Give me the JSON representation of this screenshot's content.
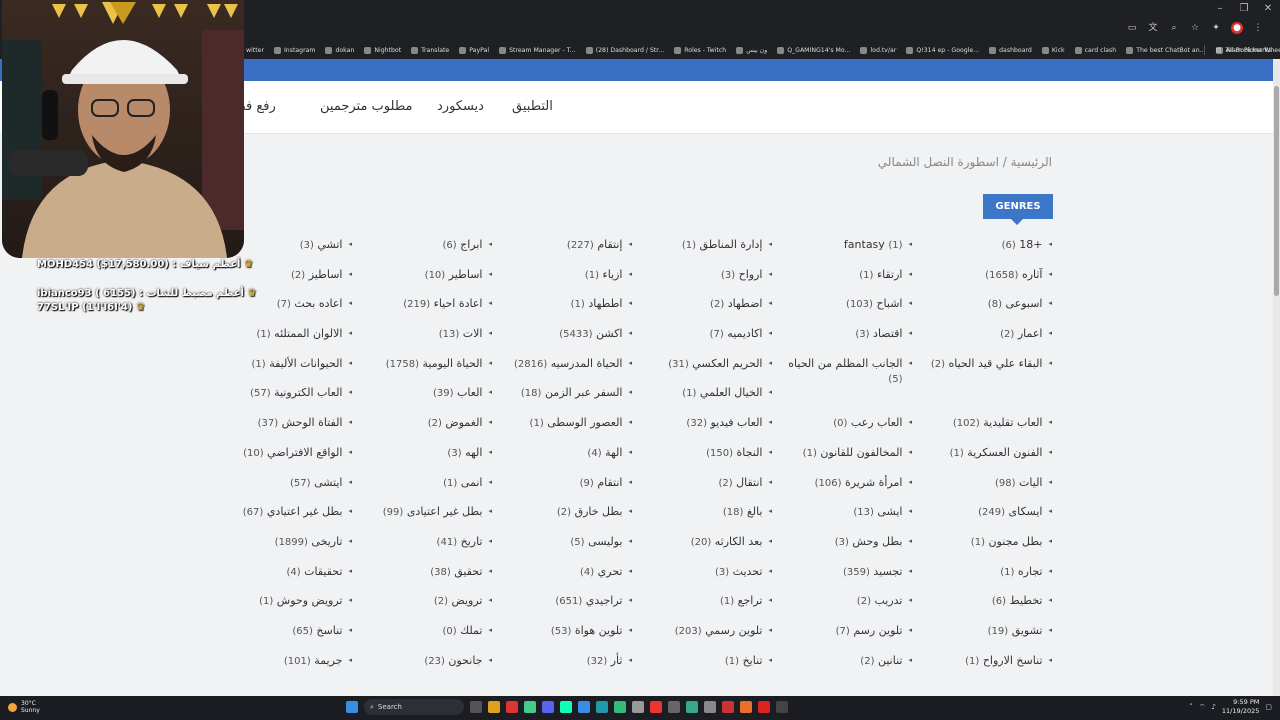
{
  "browser": {
    "bookmarks": [
      "witter",
      "Instagram",
      "dokan",
      "Nightbot",
      "Translate",
      "PayPal",
      "Stream Manager - T...",
      "(28) Dashboard / Str...",
      "Roles - Twitch",
      "ون بيس",
      "Q_GAMING14's Mo...",
      "lod.tv/ar",
      "Q!314 ep - Google...",
      "dashboard",
      "Kick",
      "card clash",
      "The best ChatBot an...",
      "Team Picker Wheel..."
    ],
    "all_bookmarks": "All Bookmarks"
  },
  "nav": {
    "app": "التطبيق",
    "discord": "ديسكورد",
    "translators": "مطلوب مترجمين",
    "upload": "رفع فصو"
  },
  "breadcrumb": "الرئيسية / اسطورة النصل الشمالي",
  "genres_button": "GENRES",
  "genres": [
    {
      "name": "+18",
      "count": "(6)"
    },
    {
      "name": "fantasy",
      "count": "(1)"
    },
    {
      "name": "إدارة المناطق",
      "count": "(1)"
    },
    {
      "name": "إنتقام",
      "count": "(227)"
    },
    {
      "name": "ابراج",
      "count": "(6)"
    },
    {
      "name": "اتشي",
      "count": "(3)"
    },
    {
      "name": "آثاره",
      "count": "(1658)"
    },
    {
      "name": "ارتقاء",
      "count": "(1)"
    },
    {
      "name": "ارواح",
      "count": "(3)"
    },
    {
      "name": "ازياء",
      "count": "(1)"
    },
    {
      "name": "اساطير",
      "count": "(10)"
    },
    {
      "name": "اساطيز",
      "count": "(2)"
    },
    {
      "name": "اسبوعى",
      "count": "(8)"
    },
    {
      "name": "اشباح",
      "count": "(103)"
    },
    {
      "name": "اضطهاد",
      "count": "(2)"
    },
    {
      "name": "اططهاد",
      "count": "(1)"
    },
    {
      "name": "اعادة احياء",
      "count": "(219)"
    },
    {
      "name": "اعاده بحث",
      "count": "(7)"
    },
    {
      "name": "اعمار",
      "count": "(2)"
    },
    {
      "name": "اقتصاد",
      "count": "(3)"
    },
    {
      "name": "اكاديميه",
      "count": "(7)"
    },
    {
      "name": "اكشن",
      "count": "(5433)"
    },
    {
      "name": "الات",
      "count": "(13)"
    },
    {
      "name": "الالوان الممتلئه",
      "count": "(1)"
    },
    {
      "name": "البقاء علي قيد الحياه",
      "count": "(2)"
    },
    {
      "name": "الجانب المظلم من الحياه",
      "count": "(5)"
    },
    {
      "name": "الحريم العكسي",
      "count": "(31)"
    },
    {
      "name": "الحياة المدرسيه",
      "count": "(2816)"
    },
    {
      "name": "الحياة اليومية",
      "count": "(1758)"
    },
    {
      "name": "الحيوانات الأليفة",
      "count": "(1)"
    },
    {
      "name": "",
      "count": ""
    },
    {
      "name": "",
      "count": ""
    },
    {
      "name": "الخيال العلمي",
      "count": "(1)"
    },
    {
      "name": "السفر عبر الزمن",
      "count": "(18)"
    },
    {
      "name": "العاب",
      "count": "(39)"
    },
    {
      "name": "العاب الكترونية",
      "count": "(57)"
    },
    {
      "name": "العاب تقليدية",
      "count": "(102)"
    },
    {
      "name": "العاب رعب",
      "count": "(0)"
    },
    {
      "name": "العاب فيديو",
      "count": "(32)"
    },
    {
      "name": "العصور الوسطى",
      "count": "(1)"
    },
    {
      "name": "الغموض",
      "count": "(2)"
    },
    {
      "name": "الفتاة الوحش",
      "count": "(37)"
    },
    {
      "name": "الفنون العسكرية",
      "count": "(1)"
    },
    {
      "name": "المخالفون للقانون",
      "count": "(1)"
    },
    {
      "name": "النجاة",
      "count": "(150)"
    },
    {
      "name": "الهة",
      "count": "(4)"
    },
    {
      "name": "الهه",
      "count": "(3)"
    },
    {
      "name": "الواقع الافتراضي",
      "count": "(10)"
    },
    {
      "name": "اليات",
      "count": "(98)"
    },
    {
      "name": "امرأة شريرة",
      "count": "(106)"
    },
    {
      "name": "انتقال",
      "count": "(2)"
    },
    {
      "name": "انتقام",
      "count": "(9)"
    },
    {
      "name": "انمى",
      "count": "(1)"
    },
    {
      "name": "ايتشى",
      "count": "(57)"
    },
    {
      "name": "ايسكاى",
      "count": "(249)"
    },
    {
      "name": "ايشى",
      "count": "(13)"
    },
    {
      "name": "بالغ",
      "count": "(18)"
    },
    {
      "name": "بطل خارق",
      "count": "(2)"
    },
    {
      "name": "بطل غير اعتيادى",
      "count": "(99)"
    },
    {
      "name": "بطل غير اعتيادي",
      "count": "(67)"
    },
    {
      "name": "بطل مجنون",
      "count": "(1)"
    },
    {
      "name": "بطل وحش",
      "count": "(3)"
    },
    {
      "name": "بعد الكارثه",
      "count": "(20)"
    },
    {
      "name": "بوليسى",
      "count": "(5)"
    },
    {
      "name": "تاريخ",
      "count": "(41)"
    },
    {
      "name": "تاريخى",
      "count": "(1899)"
    },
    {
      "name": "تجاره",
      "count": "(1)"
    },
    {
      "name": "تجسيد",
      "count": "(359)"
    },
    {
      "name": "تحديث",
      "count": "(3)"
    },
    {
      "name": "تحري",
      "count": "(4)"
    },
    {
      "name": "تحقيق",
      "count": "(38)"
    },
    {
      "name": "تحقيقات",
      "count": "(4)"
    },
    {
      "name": "تخطيط",
      "count": "(6)"
    },
    {
      "name": "تدريب",
      "count": "(2)"
    },
    {
      "name": "تراجع",
      "count": "(1)"
    },
    {
      "name": "تراجيدي",
      "count": "(651)"
    },
    {
      "name": "ترويض",
      "count": "(2)"
    },
    {
      "name": "ترويض وحوش",
      "count": "(1)"
    },
    {
      "name": "تشويق",
      "count": "(19)"
    },
    {
      "name": "تلوين رسم",
      "count": "(7)"
    },
    {
      "name": "تلوين رسمي",
      "count": "(203)"
    },
    {
      "name": "تلوين هواة",
      "count": "(53)"
    },
    {
      "name": "تملك",
      "count": "(0)"
    },
    {
      "name": "تناسخ",
      "count": "(65)"
    },
    {
      "name": "تناسخ الارواح",
      "count": "(1)"
    },
    {
      "name": "تنانين",
      "count": "(2)"
    },
    {
      "name": "تنايخ",
      "count": "(1)"
    },
    {
      "name": "ثأر",
      "count": "(32)"
    },
    {
      "name": "جانحون",
      "count": "(23)"
    },
    {
      "name": "جريمة",
      "count": "(101)"
    }
  ],
  "overlay": {
    "donor1": "MOHD454 ($17,580.00) : أعظم سياف",
    "donor2": "ibianco93 ( 6155) : أعظم مضبط للشات",
    "donor3": "77SL'IP (1'I'I6I'4)"
  },
  "taskbar": {
    "temp": "30°C",
    "weather": "Sunny",
    "search": "Search",
    "time": "9:59 PM",
    "date": "11/19/2025"
  }
}
